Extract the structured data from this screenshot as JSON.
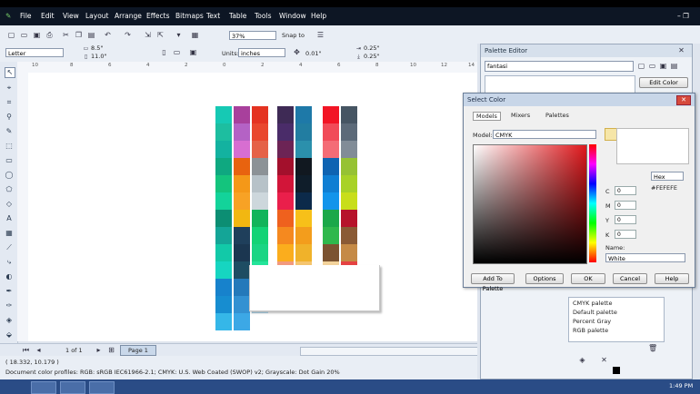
{
  "menu": {
    "items": [
      "File",
      "Edit",
      "View",
      "Layout",
      "Arrange",
      "Effects",
      "Bitmaps",
      "Text",
      "Table",
      "Tools",
      "Window",
      "Help"
    ],
    "window_controls": "– ❐"
  },
  "toolbar1": {
    "zoom": "37%",
    "snap_to": "Snap to"
  },
  "toolbar2": {
    "page_size": "Letter",
    "width": "8.5\"",
    "height": "11.0\"",
    "units_label": "Units:",
    "units": "inches",
    "nudge": "0.01\"",
    "dup_x": "0.25\"",
    "dup_y": "0.25\""
  },
  "ruler_h": [
    "10",
    "8",
    "6",
    "4",
    "2",
    "0",
    "2",
    "4",
    "6",
    "8",
    "10",
    "12",
    "14"
  ],
  "canvas": {
    "palette_columns": [
      [
        "#16c9b4",
        "#1dbea0",
        "#13b2a0",
        "#0fa880",
        "#14c47d",
        "#13d39a",
        "#0c8e73",
        "#14a597",
        "#12c9a8",
        "#16d5c1",
        "#1782cc",
        "#178dd0",
        "#35b7e8"
      ],
      [
        "#a8409c",
        "#b462c5",
        "#d76ed1",
        "#e8630f",
        "#f49818",
        "#f7a225",
        "#f2b711",
        "#1f3f5b",
        "#1b3650",
        "#1e4d63",
        "#2479ba",
        "#3391d2",
        "#3ca8e6"
      ],
      [
        "#e43321",
        "#e9472d",
        "#e56247",
        "#8c9296",
        "#b7c2c8",
        "#cdd7dc",
        "#12b45b",
        "#13d376",
        "#1ad584",
        "#23e49a",
        "#2588c4",
        "#3ba5e0"
      ],
      [
        "#3e2a55",
        "#4a2c69",
        "#6c2455",
        "#a3102c",
        "#d21539",
        "#ea1f4b",
        "#ef611e",
        "#f5891f",
        "#fbad1d",
        "#f29a7e"
      ],
      [
        "#1e79a8",
        "#227da1",
        "#2b90ac",
        "#111820",
        "#0f1d2a",
        "#0c2a4a",
        "#f7c019",
        "#f39d1c",
        "#f0b22a",
        "#f5c56f"
      ],
      [
        "#f21525",
        "#f14b58",
        "#f46c76",
        "#0e63b2",
        "#0f7ed3",
        "#1294eb",
        "#1ba849",
        "#2fb84c",
        "#7b5331",
        "#f3d39b"
      ],
      [
        "#465563",
        "#5c6a79",
        "#818c97",
        "#96c234",
        "#a8d227",
        "#c8de1a",
        "#b6132b",
        "#8a5a35",
        "#c58a46",
        "#e54242"
      ]
    ]
  },
  "statusbar": {
    "page_nav": "1 of 1",
    "page_tab": "Page 1"
  },
  "infobar": {
    "coords": "( 18.332, 10.179 )",
    "profiles": "Document color profiles: RGB: sRGB IEC61966-2.1; CMYK: U.S. Web Coated (SWOP) v2; Grayscale: Dot Gain 20%"
  },
  "palette_editor": {
    "title": "Palette Editor",
    "palette_name": "fantasi",
    "edit_color": "Edit Color",
    "palette_list": [
      "CMYK palette",
      "Default palette",
      "Percent Gray",
      "RGB palette"
    ]
  },
  "select_color": {
    "title": "Select Color",
    "tabs": [
      "Models",
      "Mixers",
      "Palettes"
    ],
    "model_label": "Model:",
    "model": "CMYK",
    "hex_dropdown": "Hex",
    "hex_value": "#FEFEFE",
    "channels": [
      {
        "label": "C",
        "value": "0"
      },
      {
        "label": "M",
        "value": "0"
      },
      {
        "label": "Y",
        "value": "0"
      },
      {
        "label": "K",
        "value": "0"
      }
    ],
    "name_label": "Name:",
    "name_value": "White",
    "buttons": {
      "add": "Add To Palette",
      "options": "Options",
      "ok": "OK",
      "cancel": "Cancel",
      "help": "Help"
    },
    "new_color": "#ffffff"
  },
  "taskbar": {
    "clock": "1:49 PM"
  }
}
